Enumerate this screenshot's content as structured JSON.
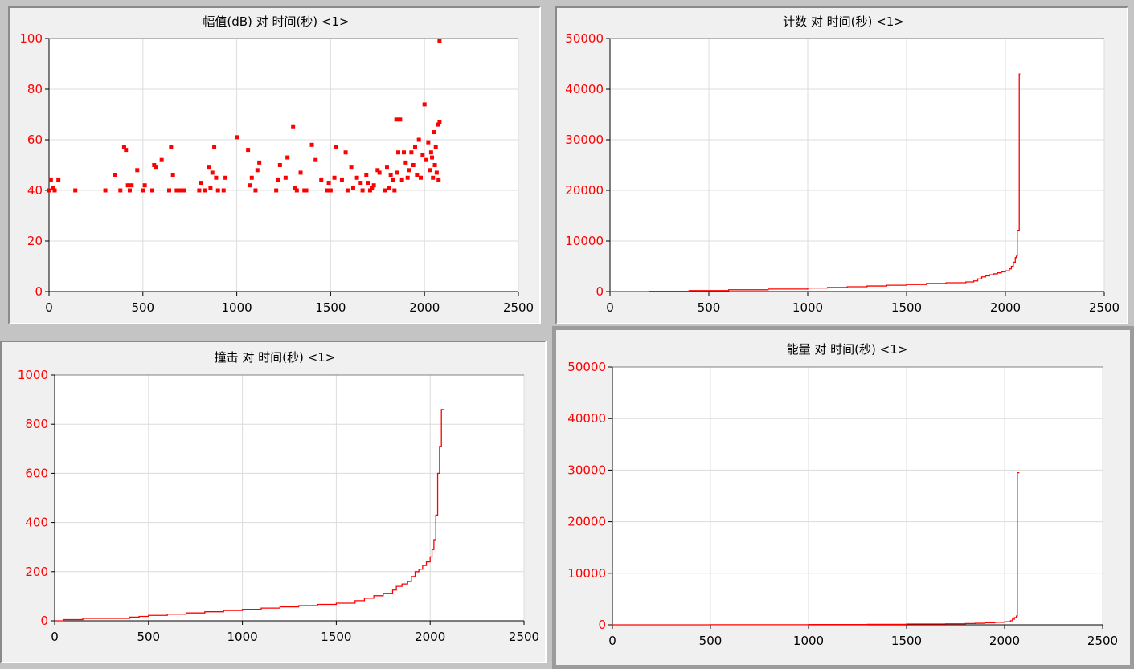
{
  "colors": {
    "series": "#ff0000",
    "grid": "#dcdcdc",
    "axis": "#000000",
    "panel_bg": "#f0f0f0",
    "plot_bg": "#ffffff"
  },
  "chart_data": [
    {
      "id": "amplitude",
      "type": "scatter",
      "title": "幅值(dB) 对 时间(秒) <1>",
      "xlim": [
        0,
        2500
      ],
      "ylim": [
        0,
        100
      ],
      "xticks": [
        0,
        500,
        1000,
        1500,
        2000,
        2500
      ],
      "yticks": [
        0,
        20,
        40,
        60,
        80,
        100
      ],
      "grid": true,
      "x": [
        0,
        10,
        20,
        30,
        50,
        140,
        300,
        350,
        380,
        400,
        410,
        420,
        430,
        440,
        470,
        500,
        510,
        550,
        560,
        570,
        600,
        640,
        650,
        660,
        680,
        700,
        720,
        800,
        810,
        830,
        850,
        860,
        870,
        880,
        890,
        900,
        930,
        940,
        1000,
        1060,
        1070,
        1080,
        1100,
        1110,
        1120,
        1210,
        1220,
        1230,
        1260,
        1270,
        1300,
        1310,
        1320,
        1340,
        1360,
        1370,
        1400,
        1420,
        1450,
        1480,
        1490,
        1500,
        1520,
        1530,
        1560,
        1580,
        1590,
        1610,
        1620,
        1640,
        1660,
        1670,
        1690,
        1700,
        1710,
        1720,
        1730,
        1750,
        1760,
        1790,
        1800,
        1810,
        1820,
        1830,
        1840,
        1850,
        1855,
        1860,
        1870,
        1880,
        1890,
        1900,
        1910,
        1920,
        1930,
        1940,
        1950,
        1960,
        1970,
        1980,
        1990,
        2000,
        2010,
        2020,
        2030,
        2035,
        2040,
        2045,
        2050,
        2055,
        2060,
        2065,
        2070,
        2075,
        2080,
        2080
      ],
      "y": [
        40,
        44,
        41,
        40,
        44,
        40,
        40,
        46,
        40,
        57,
        56,
        42,
        40,
        42,
        48,
        40,
        42,
        40,
        50,
        49,
        52,
        40,
        57,
        46,
        40,
        40,
        40,
        40,
        43,
        40,
        49,
        41,
        47,
        57,
        45,
        40,
        40,
        45,
        61,
        56,
        42,
        45,
        40,
        48,
        51,
        40,
        44,
        50,
        45,
        53,
        65,
        41,
        40,
        47,
        40,
        40,
        58,
        52,
        44,
        40,
        43,
        40,
        45,
        57,
        44,
        55,
        40,
        49,
        41,
        45,
        43,
        40,
        46,
        43,
        40,
        41,
        42,
        48,
        47,
        40,
        49,
        41,
        46,
        44,
        40,
        68,
        47,
        55,
        68,
        44,
        55,
        51,
        45,
        48,
        55,
        50,
        57,
        46,
        60,
        45,
        54,
        74,
        52,
        59,
        48,
        55,
        53,
        45,
        63,
        50,
        57,
        47,
        66,
        44,
        67,
        99
      ],
      "marker": "square"
    },
    {
      "id": "counts",
      "type": "line",
      "step": true,
      "title": "计数 对 时间(秒) <1>",
      "xlim": [
        0,
        2500
      ],
      "ylim": [
        0,
        50000
      ],
      "xticks": [
        0,
        500,
        1000,
        1500,
        2000,
        2500
      ],
      "yticks": [
        0,
        10000,
        20000,
        30000,
        40000,
        50000
      ],
      "grid": true,
      "x": [
        0,
        200,
        400,
        600,
        800,
        1000,
        1100,
        1200,
        1300,
        1400,
        1500,
        1600,
        1700,
        1800,
        1840,
        1860,
        1880,
        1900,
        1920,
        1940,
        1960,
        1980,
        2000,
        2020,
        2030,
        2040,
        2050,
        2055,
        2060,
        2065,
        2070,
        2075
      ],
      "y": [
        0,
        60,
        200,
        350,
        500,
        700,
        800,
        950,
        1100,
        1250,
        1400,
        1600,
        1750,
        1900,
        2100,
        2500,
        2900,
        3100,
        3300,
        3500,
        3700,
        3900,
        4100,
        4500,
        5000,
        5800,
        6700,
        7000,
        12000,
        12000,
        43000,
        43000
      ]
    },
    {
      "id": "hits",
      "type": "line",
      "step": true,
      "title": "撞击 对 时间(秒) <1>",
      "xlim": [
        0,
        2500
      ],
      "ylim": [
        0,
        1000
      ],
      "xticks": [
        0,
        500,
        1000,
        1500,
        2000,
        2500
      ],
      "yticks": [
        0,
        200,
        400,
        600,
        800,
        1000
      ],
      "grid": true,
      "x": [
        0,
        50,
        150,
        300,
        400,
        450,
        500,
        600,
        700,
        800,
        900,
        1000,
        1100,
        1200,
        1300,
        1400,
        1500,
        1600,
        1650,
        1700,
        1750,
        1800,
        1820,
        1850,
        1880,
        1900,
        1920,
        1940,
        1960,
        1980,
        2000,
        2010,
        2020,
        2030,
        2040,
        2050,
        2055,
        2060,
        2065,
        2070,
        2075
      ],
      "y": [
        0,
        5,
        10,
        10,
        15,
        18,
        22,
        27,
        32,
        37,
        42,
        47,
        52,
        57,
        62,
        67,
        72,
        82,
        92,
        102,
        112,
        125,
        140,
        150,
        160,
        180,
        200,
        210,
        225,
        240,
        260,
        290,
        330,
        430,
        600,
        710,
        710,
        860,
        860,
        860,
        860
      ]
    },
    {
      "id": "energy",
      "type": "line",
      "step": true,
      "title": "能量 对 时间(秒) <1>",
      "xlim": [
        0,
        2500
      ],
      "ylim": [
        0,
        50000
      ],
      "xticks": [
        0,
        500,
        1000,
        1500,
        2000,
        2500
      ],
      "yticks": [
        0,
        10000,
        20000,
        30000,
        40000,
        50000
      ],
      "grid": true,
      "x": [
        0,
        500,
        1000,
        1300,
        1500,
        1700,
        1800,
        1850,
        1900,
        1950,
        2000,
        2030,
        2040,
        2050,
        2060,
        2065,
        2070,
        2075
      ],
      "y": [
        0,
        20,
        60,
        100,
        150,
        200,
        250,
        300,
        400,
        500,
        600,
        800,
        1100,
        1400,
        1700,
        29500,
        29500,
        29500
      ]
    }
  ]
}
